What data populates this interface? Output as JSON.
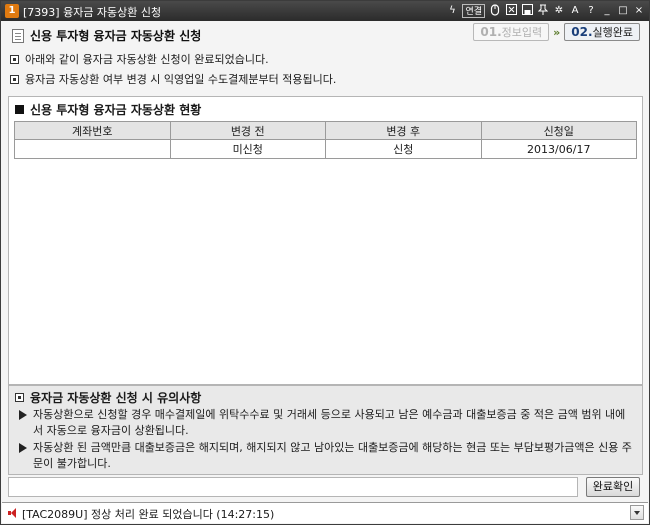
{
  "window": {
    "badge": "1",
    "title": "[7393] 융자금 자동상환 신청",
    "tools": {
      "link_label": "연결",
      "help_label": "?",
      "minimize": "_",
      "restore": "□",
      "close": "×"
    }
  },
  "header": {
    "page_title": "신용 투자형 융자금 자동상환 신청",
    "steps": [
      {
        "num": "01.",
        "label": "정보입력",
        "state": "inactive"
      },
      {
        "num": "02.",
        "label": "실행완료",
        "state": "active"
      }
    ],
    "step_arrow": "»",
    "notices": [
      "아래와 같이 융자금 자동상환 신청이 완료되었습니다.",
      "융자금 자동상환 여부 변경 시 익영업일 수도결제분부터 적용됩니다."
    ]
  },
  "status_section": {
    "title": "신용 투자형 융자금 자동상환 현황",
    "columns": [
      "계좌번호",
      "변경 전",
      "변경 후",
      "신청일"
    ],
    "rows": [
      [
        "",
        "미신청",
        "신청",
        "2013/06/17"
      ]
    ]
  },
  "caution": {
    "title": "융자금 자동상환 신청 시 유의사항",
    "items": [
      "자동상환으로 신청할 경우 매수결제일에 위탁수수료 및 거래세 등으로 사용되고 남은 예수금과 대출보증금 중 적은 금액 범위 내에서 자동으로 융자금이 상환됩니다.",
      "자동상환 된 금액만큼 대출보증금은 해지되며, 해지되지 않고 남아있는 대출보증금에 해당하는 현금 또는 부담보평가금액은 신용 주문이 불가합니다."
    ]
  },
  "actions": {
    "confirm_label": "완료확인"
  },
  "statusbar": {
    "message": "[TAC2089U] 정상 처리 완료 되었습니다 (14:27:15)"
  },
  "colors": {
    "titlebar": "#2b2b2b",
    "badge": "#e07a10",
    "active_step_num": "#1a3f7a",
    "speaker": "#cc2222"
  }
}
